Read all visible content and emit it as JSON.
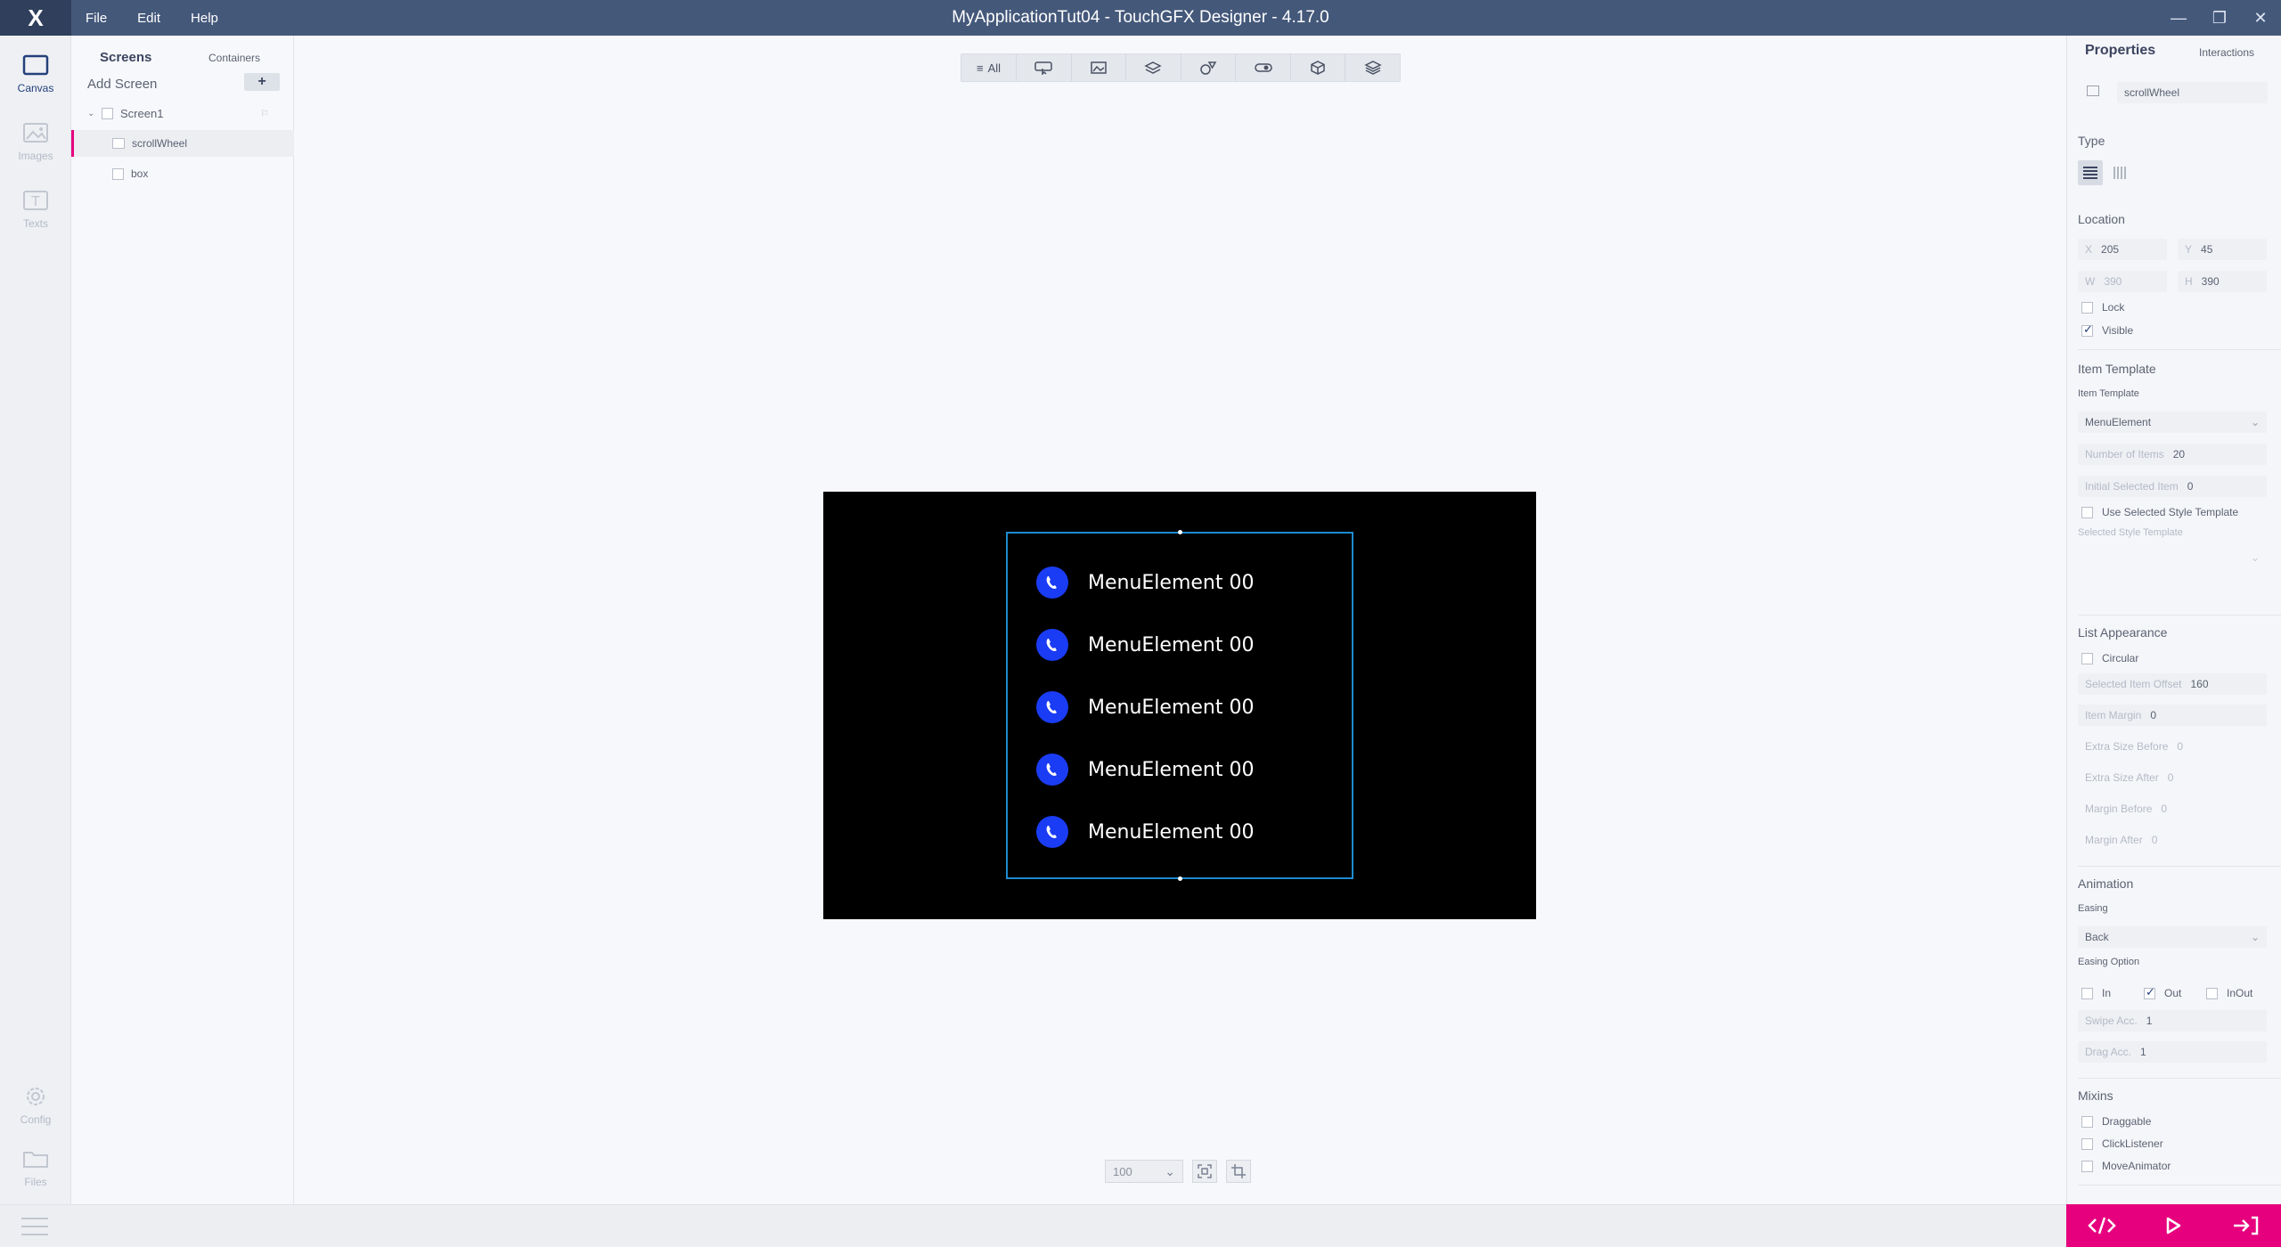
{
  "titlebar": {
    "title": "MyApplicationTut04 - TouchGFX Designer - 4.17.0",
    "logo": "X",
    "menu": [
      "File",
      "Edit",
      "Help"
    ],
    "minimize": "—",
    "maximize": "❐",
    "close": "✕"
  },
  "rail": {
    "items": [
      {
        "label": "Canvas",
        "icon": "canvas-icon"
      },
      {
        "label": "Images",
        "icon": "images-icon"
      },
      {
        "label": "Texts",
        "icon": "texts-icon"
      },
      {
        "label": "Config",
        "icon": "gear-icon"
      },
      {
        "label": "Files",
        "icon": "folder-icon"
      }
    ]
  },
  "tree": {
    "tab_screens": "Screens",
    "tab_containers": "Containers",
    "add_screen": "Add Screen",
    "add_button": "+",
    "screen_name": "Screen1",
    "widgets": [
      "scrollWheel",
      "box"
    ]
  },
  "toolbar": {
    "all_label": "All",
    "groups": [
      "interaction-icon",
      "images-icon",
      "containers-icon",
      "shapes-icon",
      "controls-icon",
      "3d-icon",
      "layers-icon"
    ]
  },
  "canvas": {
    "menu_items": [
      "MenuElement 00",
      "MenuElement 00",
      "MenuElement 00",
      "MenuElement 00",
      "MenuElement 00"
    ],
    "zoom": "100"
  },
  "properties": {
    "tab_properties": "Properties",
    "tab_interactions": "Interactions",
    "widget_name": "scrollWheel",
    "type_title": "Type",
    "location_title": "Location",
    "x_label": "X",
    "x_value": "205",
    "y_label": "Y",
    "y_value": "45",
    "w_label": "W",
    "w_value": "390",
    "h_label": "H",
    "h_value": "390",
    "lock_label": "Lock",
    "visible_label": "Visible",
    "item_template_title": "Item Template",
    "item_template_label": "Item Template",
    "item_template_value": "MenuElement",
    "num_items_label": "Number of Items",
    "num_items_value": "20",
    "initial_sel_label": "Initial Selected Item",
    "initial_sel_value": "0",
    "use_selected_label": "Use Selected Style Template",
    "selected_style_label": "Selected Style Template",
    "list_appearance_title": "List Appearance",
    "circular_label": "Circular",
    "sel_offset_label": "Selected Item Offset",
    "sel_offset_value": "160",
    "item_margin_label": "Item Margin",
    "item_margin_value": "0",
    "extra_before_label": "Extra Size Before",
    "extra_before_value": "0",
    "extra_after_label": "Extra Size After",
    "extra_after_value": "0",
    "margin_before_label": "Margin Before",
    "margin_before_value": "0",
    "margin_after_label": "Margin After",
    "margin_after_value": "0",
    "animation_title": "Animation",
    "easing_label": "Easing",
    "easing_value": "Back",
    "easing_option_label": "Easing Option",
    "opt_in": "In",
    "opt_out": "Out",
    "opt_inout": "InOut",
    "swipe_label": "Swipe Acc.",
    "swipe_value": "1",
    "drag_label": "Drag Acc.",
    "drag_value": "1",
    "mixins_title": "Mixins",
    "mixin_draggable": "Draggable",
    "mixin_click": "ClickListener",
    "mixin_move": "MoveAnimator"
  },
  "colors": {
    "titlebar": "#44587a",
    "accent": "#e6007e",
    "selection": "#1e8bd0",
    "icon_blue": "#1b3cf5"
  }
}
